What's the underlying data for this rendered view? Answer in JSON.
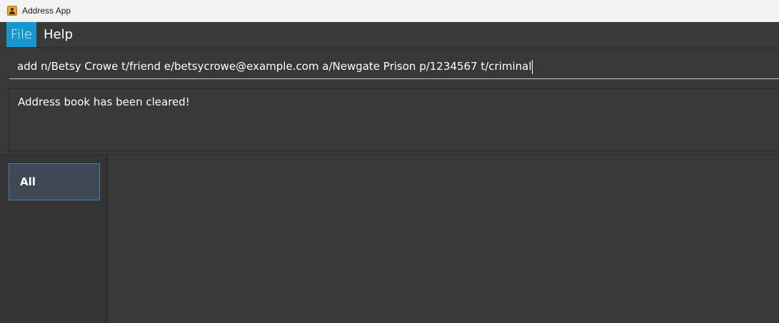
{
  "window": {
    "title": "Address App"
  },
  "menubar": {
    "items": [
      {
        "label": "File"
      },
      {
        "label": "Help"
      }
    ]
  },
  "command": {
    "value": "add n/Betsy Crowe t/friend e/betsycrowe@example.com a/Newgate Prison p/1234567 t/criminal"
  },
  "result": {
    "message": "Address book has been cleared!"
  },
  "sidebar": {
    "filters": [
      {
        "label": "All",
        "selected": true
      }
    ]
  },
  "colors": {
    "background": "#383838",
    "accent": "#1797cf",
    "selection": "#3f4855"
  },
  "icons": {
    "app": "address-book-icon"
  }
}
